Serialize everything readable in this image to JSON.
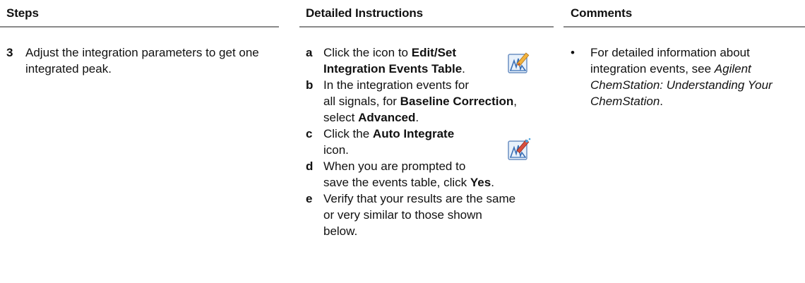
{
  "header": {
    "steps": "Steps",
    "detailed": "Detailed Instructions",
    "comments": "Comments"
  },
  "step": {
    "number": "3",
    "text": "Adjust the integration parameters to get one integrated peak."
  },
  "instructions": {
    "a": {
      "letter": "a",
      "pre": "Click the icon to ",
      "bold1": "Edit/Set",
      "bold2": "Integration Events Table",
      "post": "."
    },
    "b": {
      "letter": "b",
      "line1": "In the integration events for",
      "line2_pre": "all signals, for ",
      "line2_bold": "Baseline Correction",
      "line2_post": ",",
      "line3_pre": "select ",
      "line3_bold": "Advanced",
      "line3_post": "."
    },
    "c": {
      "letter": "c",
      "pre": "Click the ",
      "bold": "Auto Integrate",
      "line2": "icon."
    },
    "d": {
      "letter": "d",
      "line1": "When you are prompted to",
      "line2_pre": "save the events table, click ",
      "line2_bold": "Yes",
      "line2_post": "."
    },
    "e": {
      "letter": "e",
      "line1": "Verify that your results are the same",
      "line2": "or very similar to those shown",
      "line3": "below."
    }
  },
  "comments": {
    "bullet": "•",
    "line1": "For detailed information about",
    "line2_pre": "integration events, see ",
    "line2_ital": "Agilent",
    "line3_ital": "ChemStation: Understanding Your",
    "line4_ital": "ChemStation",
    "line4_post": "."
  },
  "icons": {
    "edit_events": "edit-integration-events-icon",
    "auto_integrate": "auto-integrate-icon"
  }
}
